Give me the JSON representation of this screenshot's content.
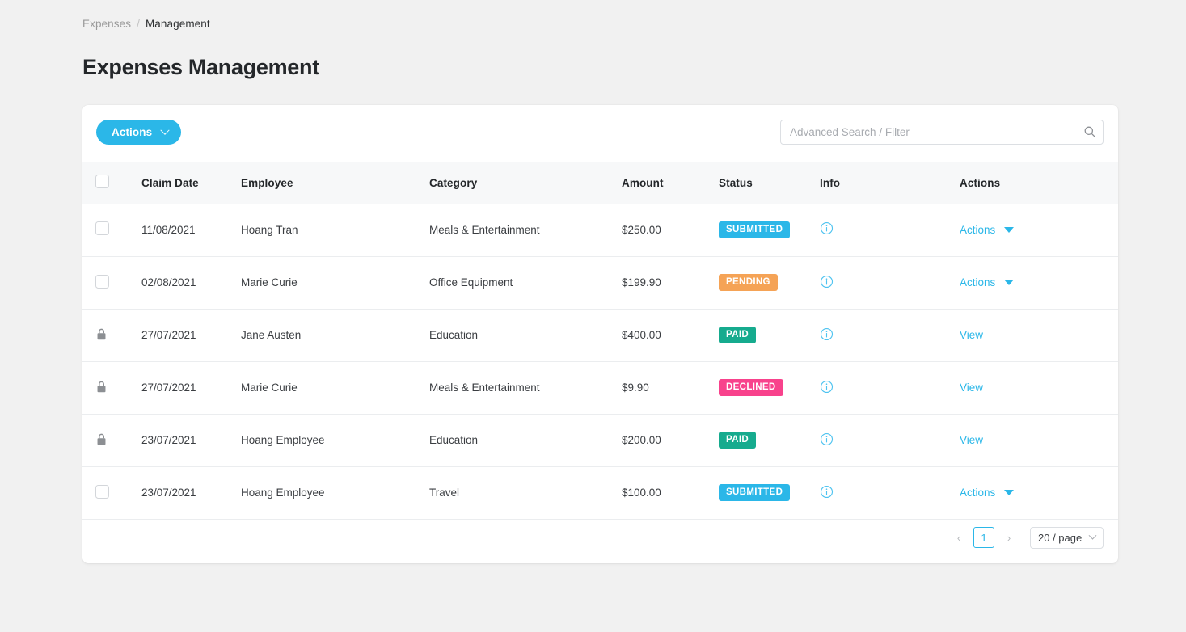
{
  "breadcrumb": {
    "parent": "Expenses",
    "separator": "/",
    "current": "Management"
  },
  "page_title": "Expenses Management",
  "toolbar": {
    "actions_label": "Actions",
    "search_placeholder": "Advanced Search / Filter",
    "search_value": ""
  },
  "table": {
    "columns": [
      "Claim Date",
      "Employee",
      "Category",
      "Amount",
      "Status",
      "Info",
      "Actions"
    ],
    "rows": [
      {
        "locked": false,
        "date": "11/08/2021",
        "employee": "Hoang Tran",
        "category": "Meals & Entertainment",
        "amount": "$250.00",
        "status": "SUBMITTED",
        "status_kind": "submitted",
        "action_label": "Actions"
      },
      {
        "locked": false,
        "date": "02/08/2021",
        "employee": "Marie Curie",
        "category": "Office Equipment",
        "amount": "$199.90",
        "status": "PENDING",
        "status_kind": "pending",
        "action_label": "Actions"
      },
      {
        "locked": true,
        "date": "27/07/2021",
        "employee": "Jane Austen",
        "category": "Education",
        "amount": "$400.00",
        "status": "PAID",
        "status_kind": "paid",
        "action_label": "View"
      },
      {
        "locked": true,
        "date": "27/07/2021",
        "employee": "Marie Curie",
        "category": "Meals & Entertainment",
        "amount": "$9.90",
        "status": "DECLINED",
        "status_kind": "declined",
        "action_label": "View"
      },
      {
        "locked": true,
        "date": "23/07/2021",
        "employee": "Hoang Employee",
        "category": "Education",
        "amount": "$200.00",
        "status": "PAID",
        "status_kind": "paid",
        "action_label": "View"
      },
      {
        "locked": false,
        "date": "23/07/2021",
        "employee": "Hoang Employee",
        "category": "Travel",
        "amount": "$100.00",
        "status": "SUBMITTED",
        "status_kind": "submitted",
        "action_label": "Actions"
      }
    ]
  },
  "pagination": {
    "prev": "‹",
    "next": "›",
    "current_page": "1",
    "page_size": "20 / page"
  },
  "colors": {
    "accent": "#2bb7e8",
    "submitted": "#2bb7e8",
    "pending": "#f5a356",
    "paid": "#16ab8e",
    "declined": "#f8428c",
    "page_background": "#f1f1f1",
    "header_background": "#f7f8f9"
  }
}
